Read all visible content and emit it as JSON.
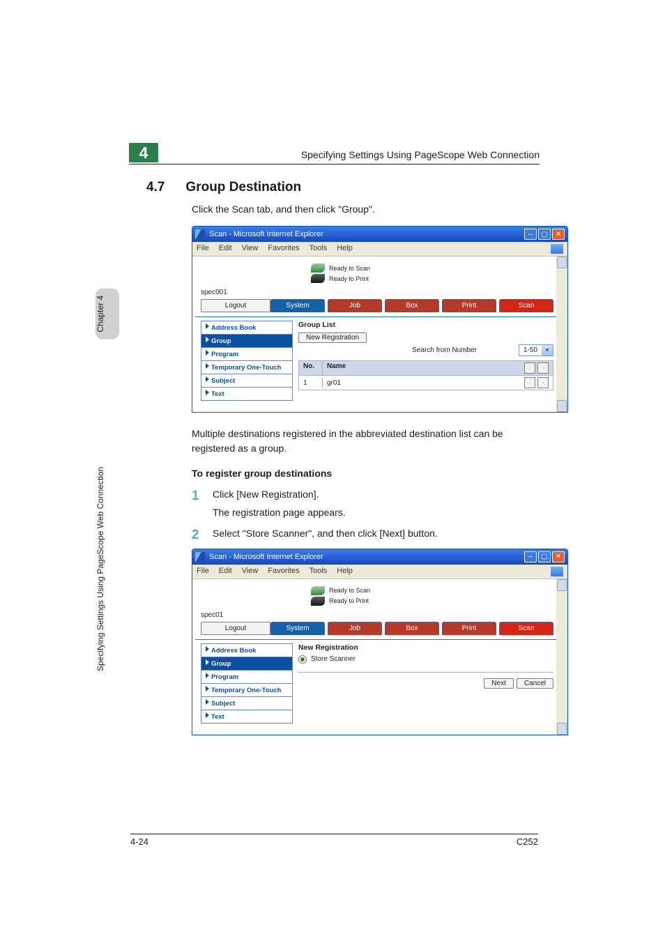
{
  "header": {
    "chapter_num": "4",
    "running_title": "Specifying Settings Using PageScope Web Connection"
  },
  "side": {
    "chapter_tab": "Chapter 4",
    "long": "Specifying Settings Using PageScope Web Connection"
  },
  "section": {
    "number": "4.7",
    "title": "Group Destination",
    "para1": "Click the Scan tab, and then click \"Group\".",
    "para2": "Multiple destinations registered in the abbreviated destination list can be registered as a group.",
    "subhead": "To register group destinations",
    "step1": "Click [New Registration].",
    "step1b": "The registration page appears.",
    "step2": "Select \"Store Scanner\", and then click [Next] button."
  },
  "browser": {
    "title": "Scan - Microsoft Internet Explorer",
    "menus": [
      "File",
      "Edit",
      "View",
      "Favorites",
      "Tools",
      "Help"
    ],
    "status_scan": "Ready to Scan",
    "status_print": "Ready to Print",
    "logout": "Logout",
    "tabs": {
      "system": "System",
      "job": "Job",
      "box": "Box",
      "print": "Print",
      "scan": "Scan"
    },
    "nav": [
      "Address Book",
      "Group",
      "Program",
      "Temporary One-Touch",
      "Subject",
      "Text"
    ]
  },
  "shot1": {
    "spec": "spec001",
    "pane_title": "Group List",
    "newreg": "New Registration",
    "search_label": "Search from Number",
    "range": "1-50",
    "col_no": "No.",
    "col_name": "Name",
    "row_no": "1",
    "row_name": "gr01"
  },
  "shot2": {
    "spec": "spec01",
    "pane_title": "New Registration",
    "radio_label": "Store Scanner",
    "next": "Next",
    "cancel": "Cancel"
  },
  "footer": {
    "page": "4-24",
    "model": "C252"
  }
}
